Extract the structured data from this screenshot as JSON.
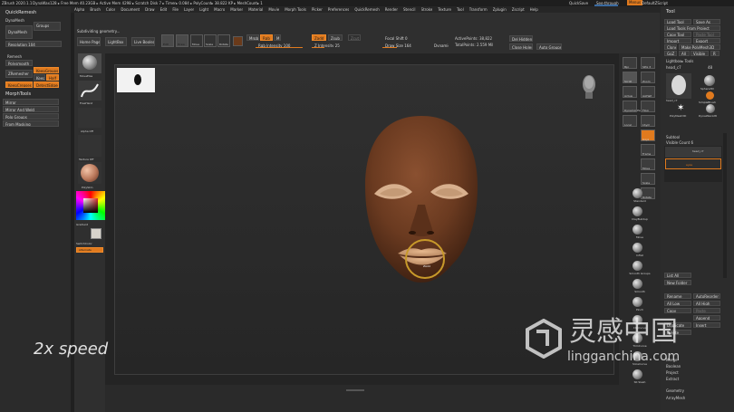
{
  "titlebar": {
    "app": "ZBrush 2020.1.1",
    "info": "DynaWax128  ▸ Free Mem 40.23GB ▸ Active Mem 4298 ▸ Scratch Disk 7 ▸ Timer▸ 0.084 ▸ PolyCount▸ 38.822 KP ▸ MeshCount▸ 1",
    "quicksave": "QuickSave",
    "see_through": "See-through",
    "see_through_value": "0",
    "menus_btn": "Menus",
    "defaultzscript": "DefaultZScript"
  },
  "menubar": [
    "Alpha",
    "Brush",
    "Color",
    "Document",
    "Draw",
    "Edit",
    "File",
    "Layer",
    "Light",
    "Macro",
    "Marker",
    "Material",
    "Movie",
    "Morph Tools",
    "Picker",
    "Preferences",
    "QuickRemesh",
    "Render",
    "Stencil",
    "Stroke",
    "Texture",
    "Tool",
    "Transform",
    "Zplugin",
    "Zscript",
    "Help"
  ],
  "left_panel": {
    "title": "QuickRemesh",
    "dynamesh_header": "DynaMesh",
    "dynamesh": "DynaMesh",
    "groups": "Groups",
    "resolution": "Resolution 104",
    "remesh_header": "Remesh",
    "polysmooth": "Polysmooth",
    "zremesher": "ZRemesher",
    "keep_groups": "KeepGroups",
    "keep": "Keep",
    "half": "Half",
    "same": "Same",
    "keep_creases": "KeepCreases",
    "detect_edges": "DetectEdges",
    "morph_title": "MorphTools",
    "mirror": "Mirror",
    "mirror_and_weld": "Mirror And Weld",
    "polo_groups": "Polo Groups",
    "from_masking": "From Masking"
  },
  "toolbar": {
    "status": "Subdividing geometry...",
    "home_page": "Home Page",
    "lightbox": "LightBox",
    "live_boolean": "Live Boolean",
    "edit": "Edit",
    "draw": "Draw",
    "move": "Move",
    "scale": "Scale",
    "rotate": "Rotate",
    "mrgb": "Mrgb",
    "rgb": "Rgb",
    "m": "M",
    "zadd": "Zadd",
    "zsub": "Zsub",
    "zcut": "Zcut",
    "rgb_intensity": "Rgb Intensity 100",
    "z_intensity": "Z Intensity 25",
    "focal_shift": "Focal Shift 0",
    "draw_size": "Draw Size 164",
    "dynamic": "Dynamic",
    "active_points": "ActivePoints: 38,822",
    "total_points": "TotalPoints: 2.559 Mil",
    "del_hidden": "Del Hidden",
    "close_holes": "Close Holes",
    "auto_groups": "Auto Groups"
  },
  "left_shelf": {
    "brush_label": "MoveElas",
    "stroke_label": "FreeHand",
    "alpha_label": "Alpha Off",
    "texture_label": "Texture Off",
    "material_label": "PolySkin",
    "gradient": "Gradient",
    "switch_color": "SwitchColor",
    "alternate": "Alternate"
  },
  "canvas": {
    "speed_label": "2x speed",
    "brush_cursor_label": "ZAdd"
  },
  "right_shelf": [
    "Bpr",
    "SPix 3",
    "Scroll",
    "Zoom",
    "Actual",
    "AAHalf",
    "Dynamic Persp",
    "Floor",
    "Local",
    "LSym",
    "Gxyz",
    "Frame",
    "Move",
    "Scale",
    "Rotate",
    "Line Fill PolyF",
    "Transp",
    "Ghost",
    "Solo",
    "Xpose"
  ],
  "brush_palette": [
    "Standard",
    "ClayBuildup",
    "Move",
    "Inflat",
    "Smooth Groups",
    "Smooth",
    "Pinch",
    "ClipCurve",
    "TrimCurve",
    "SliceCurve",
    "SK Slash"
  ],
  "tool_panel": {
    "title": "Tool",
    "load_tool": "Load Tool",
    "save_as": "Save As",
    "load_tools_from_project": "Load Tools From Project",
    "copy_tool": "Copy Tool",
    "paste_tool": "Paste Tool",
    "import": "Import",
    "export": "Export",
    "clone": "Clone",
    "make_polymesh3d": "Make PolyMesh3D",
    "goz": "GoZ",
    "all": "All",
    "visible": "Visible",
    "r": "R",
    "lightbox_tools": "Lightbox▸ Tools",
    "current_tool": "head_c7",
    "current_tool_count": "48",
    "thumbnails": [
      "head_c7",
      "Sphere3D",
      "SimpleBrush",
      "PolyMesh3D",
      "DynaWax128"
    ],
    "subtool_title": "Subtool",
    "visible_count": "Visible Count 6",
    "subtool_items": [
      "head_c7",
      "eyes"
    ],
    "list_all": "List All",
    "new_folder": "New Folder",
    "rename": "Rename",
    "autoreorder": "AutoReorder",
    "all_low": "All Low",
    "all_high": "All High",
    "copy": "Copy",
    "paste": "Paste",
    "append": "Append",
    "duplicate": "Duplicate",
    "insert": "Insert",
    "delete": "Delete",
    "merge": "Merge",
    "boolean": "Boolean",
    "project": "Project",
    "extract": "Extract",
    "geometry": "Geometry",
    "arraymesh": "ArrayMesh"
  },
  "watermark": {
    "cn": "灵感中国",
    "url": "lingganchina.com"
  }
}
